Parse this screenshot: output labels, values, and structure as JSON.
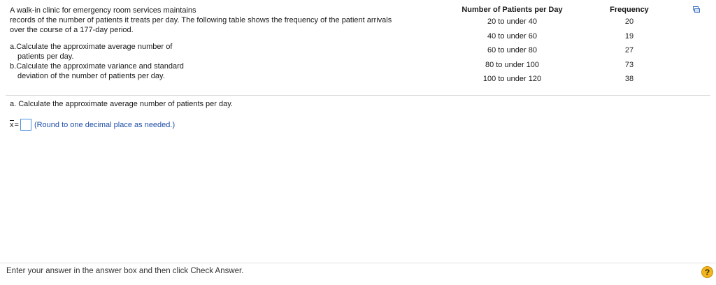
{
  "problem": {
    "intro_lines": [
      "A walk-in clinic for emergency room services maintains",
      "records of the number of patients it treats per day. The following table shows the frequency of the patient arrivals",
      "over the course of a 177-day period."
    ],
    "question_a_prefix": "a.",
    "question_a_line1": "Calculate the approximate average number of",
    "question_a_line2": "patients per day.",
    "question_b_prefix": "b.",
    "question_b_line1": "Calculate the approximate variance and standard",
    "question_b_line2": "deviation of the number of patients per day."
  },
  "table": {
    "headers": [
      "Number of Patients per Day",
      "Frequency"
    ],
    "rows": [
      [
        "20 to under 40",
        "20"
      ],
      [
        "40 to under 60",
        "19"
      ],
      [
        "60 to under 80",
        "27"
      ],
      [
        "80 to under 100",
        "73"
      ],
      [
        "100 to under 120",
        "38"
      ]
    ]
  },
  "part_a": {
    "prompt": "a. Calculate the approximate average number of patients per day.",
    "symbol": "x",
    "equals": "=",
    "answer_value": "",
    "hint": "(Round to one decimal place as needed.)"
  },
  "footer": {
    "instruction": "Enter your answer in the answer box and then click Check Answer.",
    "help_label": "?"
  },
  "icons": {
    "copy": "copy-icon",
    "help": "help-icon"
  }
}
